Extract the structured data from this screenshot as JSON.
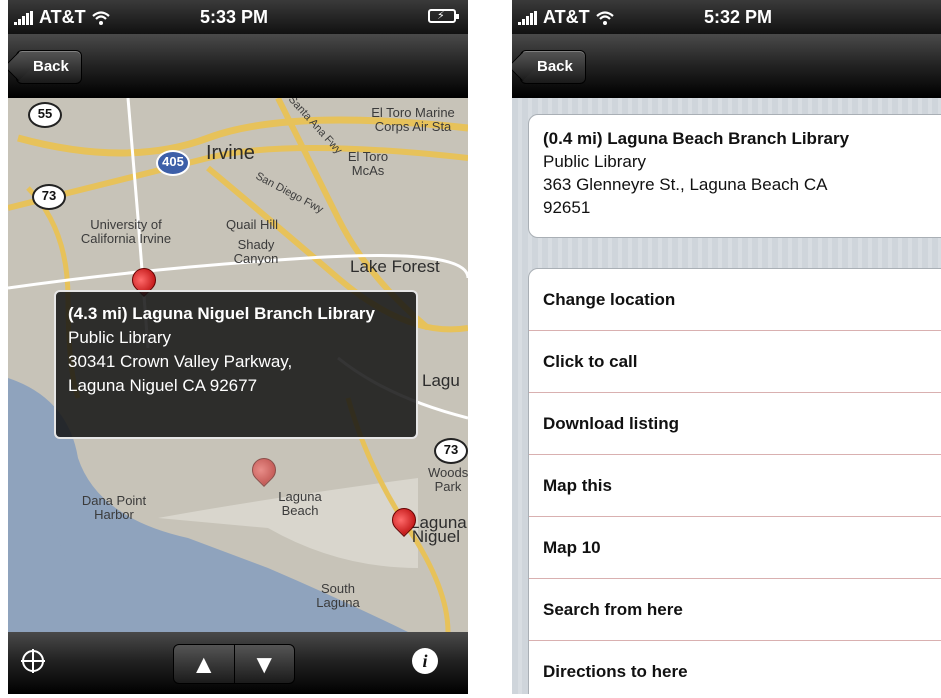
{
  "left": {
    "status": {
      "carrier": "AT&T",
      "time": "5:33 PM"
    },
    "nav": {
      "back_label": "Back"
    },
    "map": {
      "labels": {
        "irvine": "Irvine",
        "el_toro_marine": "El Toro Marine Corps Air Sta",
        "el_toro_mcas": "El Toro McAs",
        "university": "University of California Irvine",
        "quail_hill": "Quail Hill",
        "shady_canyon": "Shady Canyon",
        "lake_forest": "Lake Forest",
        "dana_point": "Dana Point Harbor",
        "laguna_beach": "Laguna Beach",
        "laguna_niguel": "Laguna Niguel",
        "south_laguna": "South Laguna",
        "laguna_woods": "Woods Park",
        "lagu": "Lagu",
        "santa_ana_fwy": "Santa Ana Fwy",
        "san_diego_fwy": "San Diego Fwy"
      },
      "shields": {
        "r55": "55",
        "r405": "405",
        "r73a": "73",
        "r73b": "73"
      }
    },
    "callout": {
      "title": "(4.3 mi) Laguna Niguel Branch Library",
      "type": "Public Library",
      "address1": "30341 Crown Valley Parkway,",
      "address2": "Laguna Niguel CA  92677"
    },
    "toolbar": {
      "up": "▲",
      "down": "▼",
      "info": "i"
    }
  },
  "right": {
    "status": {
      "carrier": "AT&T",
      "time": "5:32 PM"
    },
    "nav": {
      "back_label": "Back"
    },
    "card": {
      "title": "(0.4 mi) Laguna Beach Branch Library",
      "type": "Public Library",
      "address1": "363 Glenneyre St., Laguna Beach CA",
      "address2": "92651"
    },
    "actions": [
      "Change location",
      "Click to call",
      "Download listing",
      "Map this",
      "Map 10",
      "Search from here",
      "Directions to here"
    ]
  }
}
